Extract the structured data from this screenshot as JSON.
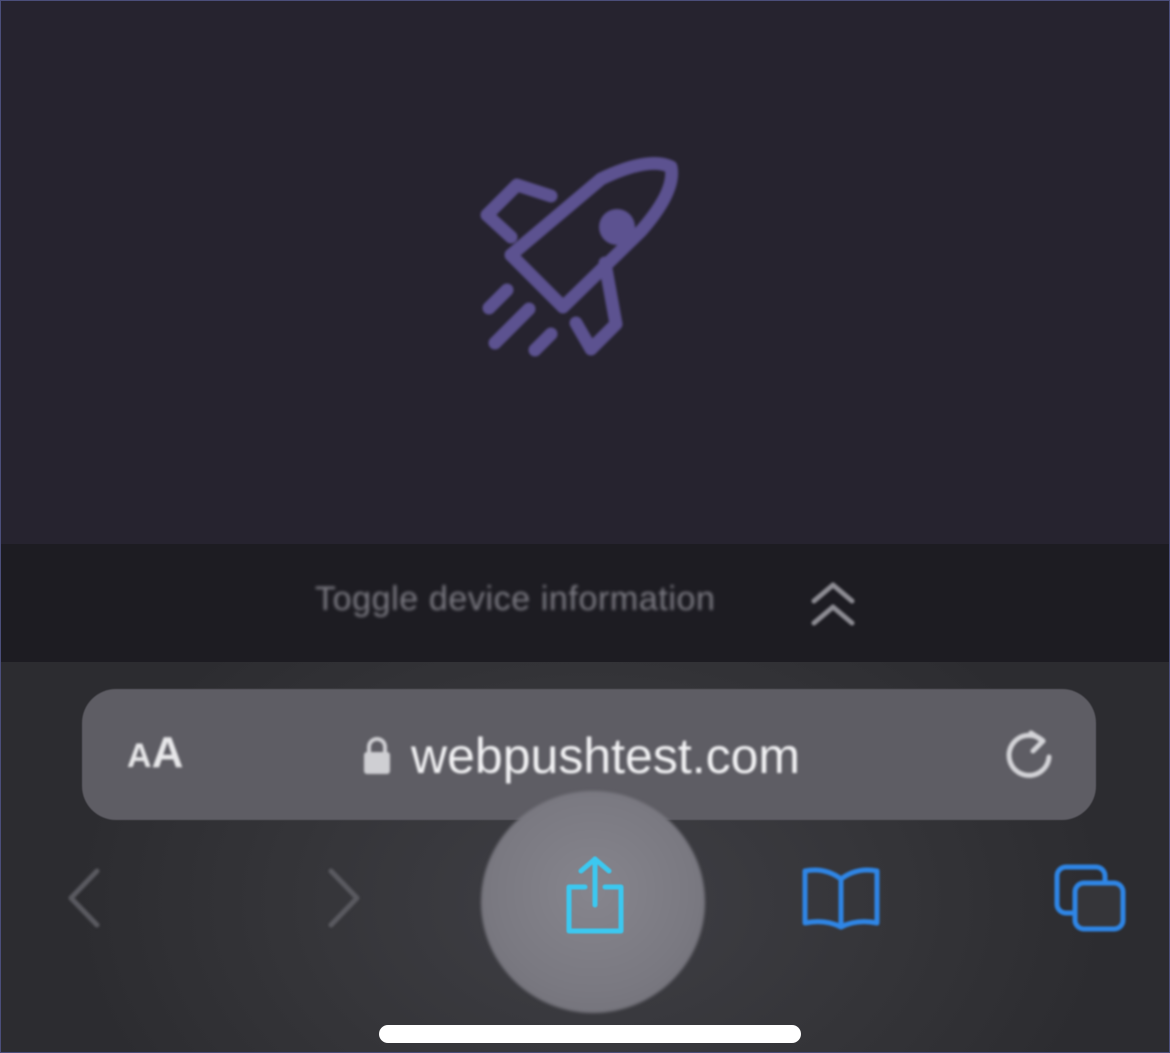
{
  "page": {
    "hero_icon": "rocket-icon",
    "accent_color": "#5c5290",
    "background_color": "#26232f"
  },
  "device_info": {
    "toggle_label": "Toggle device information",
    "toggle_icon": "double-chevron-up-icon"
  },
  "address_bar": {
    "text_size_label_small": "A",
    "text_size_label_big": "A",
    "lock_icon": "lock-icon",
    "url": "webpushtest.com",
    "reload_icon": "reload-icon"
  },
  "toolbar": {
    "back_icon": "chevron-left-icon",
    "forward_icon": "chevron-right-icon",
    "share_icon": "share-icon",
    "bookmarks_icon": "book-icon",
    "tabs_icon": "tabs-icon",
    "active_color": "#3cc8f0",
    "icon_color": "#2f86e6",
    "disabled_color": "#5a5a60"
  }
}
